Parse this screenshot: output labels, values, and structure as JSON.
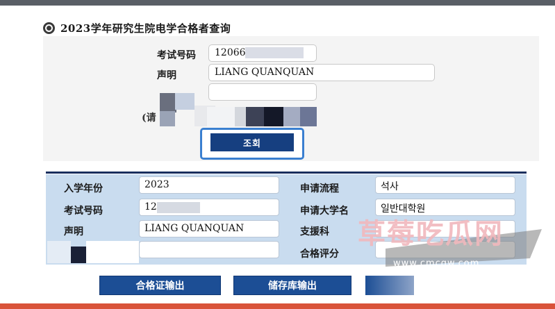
{
  "page": {
    "title": "2023学年研究生院电学合格者查询"
  },
  "query_form": {
    "exam_number_label": "考试号码",
    "exam_number_value": "12066",
    "statement_label": "声明",
    "statement_value": "LIANG QUANQUAN",
    "hint_label": "(请",
    "search_button_label": "조회"
  },
  "result": {
    "rows": [
      {
        "label": "入学年份",
        "value": "2023"
      },
      {
        "label": "考试号码",
        "value": "120"
      },
      {
        "label": "声明",
        "value": "LIANG QUANQUAN"
      },
      {
        "label": "",
        "value": ""
      }
    ],
    "right_rows": [
      {
        "label": "申请流程",
        "value": "석사"
      },
      {
        "label": "申请大学名",
        "value": "일반대학원"
      },
      {
        "label": "支援科",
        "value": ""
      },
      {
        "label": "合格评分",
        "value": ""
      }
    ]
  },
  "actions": {
    "certificate_button": "合格证输出",
    "repository_button": "储存库输出"
  },
  "watermark": {
    "main": "草莓吃瓜网",
    "url": "www.cmcgw.com"
  },
  "colors": {
    "top_bar": "#5a5f66",
    "bottom_bar": "#d9533a",
    "button_navy": "#1c4e95",
    "table_blue": "#c9dcef",
    "search_border": "#3a7fd0"
  }
}
